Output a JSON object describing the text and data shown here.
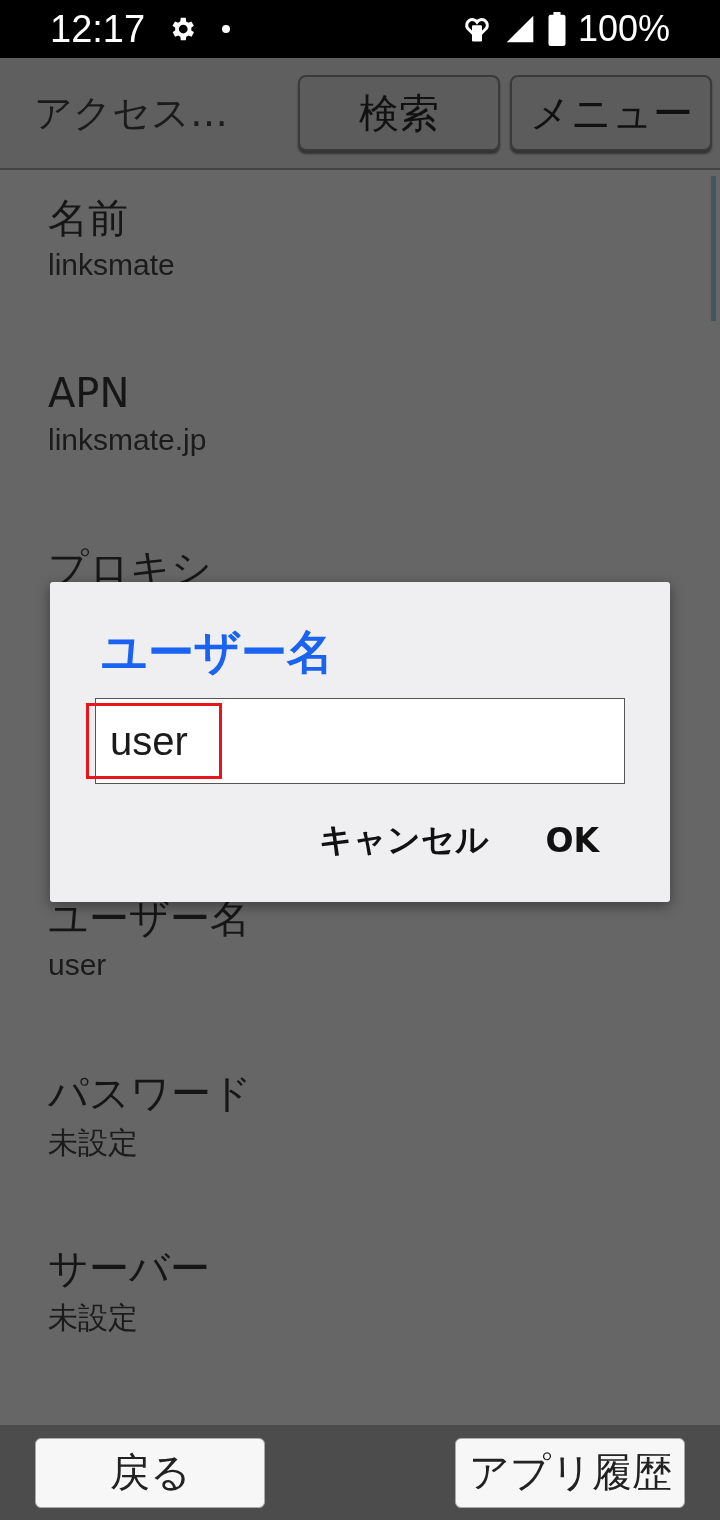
{
  "status_bar": {
    "time": "12:17",
    "battery": "100%"
  },
  "header": {
    "title": "アクセス…",
    "buttons": [
      "検索",
      "メニュー"
    ]
  },
  "settings": [
    {
      "label": "名前",
      "value": "linksmate",
      "kind": "item"
    },
    {
      "label": "APN",
      "value": "linksmate.jp",
      "kind": "item"
    },
    {
      "label": "プロキシ",
      "kind": "covered"
    },
    {
      "kind": "hidden"
    },
    {
      "label": "ユーザー名",
      "value": "user",
      "kind": "item"
    },
    {
      "label": "パスワード",
      "value": "未設定",
      "kind": "item"
    },
    {
      "label": "サーバー",
      "value": "未設定",
      "kind": "item"
    }
  ],
  "dialog": {
    "title": "ユーザー名",
    "value": "user",
    "highlighted": true,
    "buttons": [
      "キャンセル",
      "OK"
    ]
  },
  "bottom_bar": {
    "buttons": [
      "戻る",
      "アプリ履歴"
    ]
  }
}
